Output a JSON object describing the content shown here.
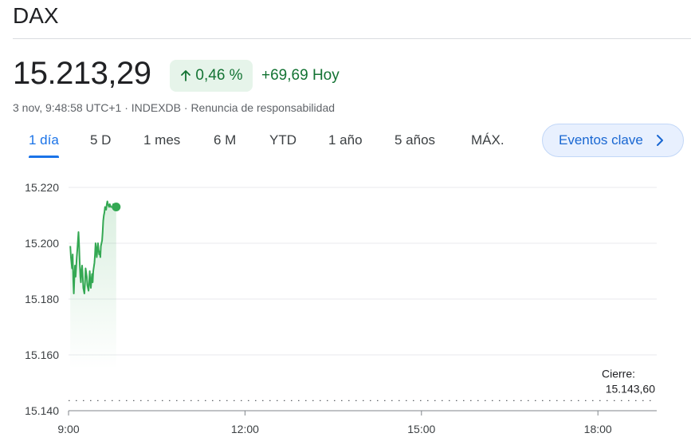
{
  "header": {
    "title": "DAX"
  },
  "quote": {
    "price": "15.213,29",
    "change_percent": "0,46 %",
    "change_value": "+69,69",
    "change_period": "Hoy",
    "meta": "3 nov, 9:48:58 UTC+1 · INDEXDB · Renuncia de responsabilidad"
  },
  "tabs": [
    {
      "label": "1 día",
      "active": true
    },
    {
      "label": "5 D"
    },
    {
      "label": "1 mes"
    },
    {
      "label": "6 M"
    },
    {
      "label": "YTD"
    },
    {
      "label": "1 año"
    },
    {
      "label": "5 años"
    },
    {
      "label": "MÁX."
    }
  ],
  "events_button": {
    "label": "Eventos clave",
    "icon": "chevron-right-icon"
  },
  "colors": {
    "up": "#137333",
    "line": "#34a853",
    "accent": "#1a73e8"
  },
  "chart_data": {
    "type": "line",
    "xlabel": "",
    "ylabel": "",
    "x_ticks": [
      "9:00",
      "12:00",
      "15:00",
      "18:00"
    ],
    "y_ticks": [
      "15.220",
      "15.200",
      "15.180",
      "15.160",
      "15.140"
    ],
    "y_tick_values": [
      15220,
      15200,
      15180,
      15160,
      15140
    ],
    "ylim": [
      15140,
      15220
    ],
    "x_range_hours": [
      9.0,
      19.0
    ],
    "previous_close": {
      "label": "Cierre:",
      "value_text": "15.143,60",
      "value": 15143.6
    },
    "series": [
      {
        "x": [
          9.03,
          9.04,
          9.06,
          9.07,
          9.08,
          9.09,
          9.1,
          9.11,
          9.12,
          9.14,
          9.15,
          9.16,
          9.17,
          9.18,
          9.19,
          9.2,
          9.21,
          9.22,
          9.23,
          9.24,
          9.25,
          9.27,
          9.28,
          9.29,
          9.31,
          9.32,
          9.34,
          9.35,
          9.36,
          9.37,
          9.38,
          9.39,
          9.4,
          9.41,
          9.42,
          9.44,
          9.45,
          9.46,
          9.47,
          9.48,
          9.5,
          9.51,
          9.52,
          9.53,
          9.54,
          9.55,
          9.57,
          9.58,
          9.59,
          9.6,
          9.61,
          9.62,
          9.64,
          9.65,
          9.66,
          9.67,
          9.69,
          9.7,
          9.72,
          9.74,
          9.75,
          9.76,
          9.77,
          9.78,
          9.79,
          9.8,
          9.81
        ],
        "values": [
          15199,
          15195,
          15191,
          15196,
          15187,
          15182,
          15188,
          15192,
          15188,
          15195,
          15198,
          15201,
          15204,
          15199,
          15193,
          15188,
          15186,
          15190,
          15192,
          15189,
          15184,
          15182,
          15186,
          15191,
          15188,
          15185,
          15183,
          15186,
          15190,
          15186,
          15184,
          15187,
          15189,
          15186,
          15190,
          15193,
          15196,
          15200,
          15198,
          15195,
          15200,
          15198,
          15196,
          15197,
          15195,
          15199,
          15201,
          15204,
          15208,
          15210,
          15211,
          15213,
          15212,
          15214,
          15215,
          15214,
          15213,
          15214,
          15213,
          15213,
          15213,
          15214,
          15213,
          15213,
          15213,
          15213,
          15213
        ]
      }
    ],
    "grid": true
  }
}
